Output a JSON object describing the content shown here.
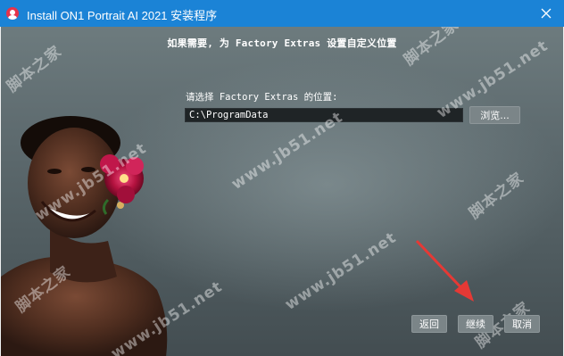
{
  "window": {
    "title": "Install ON1 Portrait AI 2021 安装程序"
  },
  "page": {
    "heading": "如果需要, 为 Factory Extras 设置自定义位置",
    "location_label": "请选择 Factory Extras 的位置:",
    "path_value": "C:\\ProgramData"
  },
  "buttons": {
    "browse": "浏览...",
    "back": "返回",
    "next": "继续",
    "cancel": "取消"
  },
  "watermarks": {
    "site_cn": "脚本之家",
    "site_url": "www.jb51.net"
  },
  "colors": {
    "titlebar": "#1b83d6",
    "arrow": "#e53935",
    "button_bg": "#7b8588",
    "input_bg": "#1f2426"
  },
  "icons": {
    "app": "app-user-icon",
    "close": "close-icon",
    "annotation": "red-arrow-icon"
  }
}
